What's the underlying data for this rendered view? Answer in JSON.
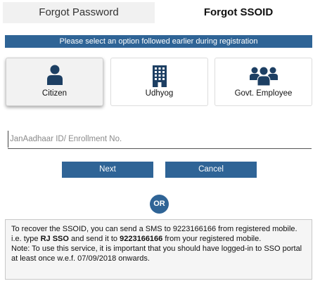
{
  "tabs": {
    "forgot_password": "Forgot Password",
    "forgot_ssoid": "Forgot SSOID"
  },
  "banner": "Please select an option followed earlier during registration",
  "options": [
    {
      "label": "Citizen",
      "icon": "person-icon",
      "selected": true
    },
    {
      "label": "Udhyog",
      "icon": "building-icon",
      "selected": false
    },
    {
      "label": "Govt. Employee",
      "icon": "group-icon",
      "selected": false
    }
  ],
  "input": {
    "placeholder": "JanAadhaar ID/ Enrollment No.",
    "value": ""
  },
  "buttons": {
    "next": "Next",
    "cancel": "Cancel"
  },
  "or_label": "OR",
  "info": {
    "line1": "To recover the SSOID, you can send a SMS to 9223166166 from registered mobile.",
    "line2_prefix": "i.e. type ",
    "line2_code": "RJ SSO",
    "line2_middle": " and send it to ",
    "line2_number": "9223166166",
    "line2_suffix": " from your registered mobile.",
    "line3": "Note: To use this service, it is important that you should have logged-in to SSO portal at least once w.e.f. 07/09/2018 onwards."
  },
  "colors": {
    "primary": "#2f6496",
    "icon": "#1d3f63"
  }
}
